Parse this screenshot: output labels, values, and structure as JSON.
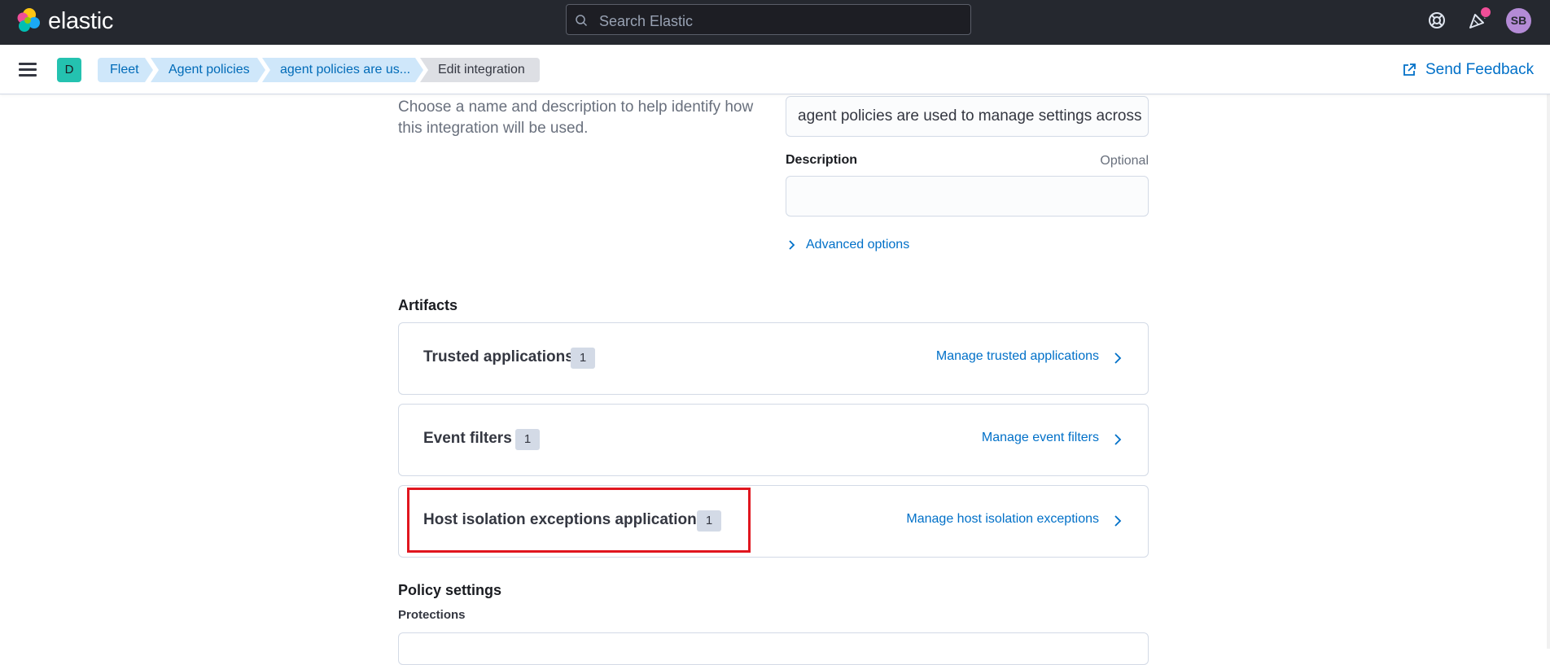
{
  "header": {
    "logo_text": "elastic",
    "search_placeholder": "Search Elastic",
    "avatar_initials": "SB"
  },
  "breadcrumb_bar": {
    "space_initial": "D",
    "crumbs": [
      "Fleet",
      "Agent policies",
      "agent policies are us...",
      "Edit integration"
    ],
    "send_feedback_label": "Send Feedback"
  },
  "integration_settings": {
    "help_text": "Choose a name and description to help identify how this integration will be used.",
    "name_value": "agent policies are used to manage settings across",
    "description_label": "Description",
    "description_optional": "Optional",
    "description_value": "",
    "advanced_options_label": "Advanced options"
  },
  "artifacts": {
    "title": "Artifacts",
    "cards": [
      {
        "title": "Trusted applications",
        "count": "1",
        "link": "Manage trusted applications"
      },
      {
        "title": "Event filters",
        "count": "1",
        "link": "Manage event filters"
      },
      {
        "title": "Host isolation exceptions applications",
        "count": "1",
        "link": "Manage host isolation exceptions"
      }
    ]
  },
  "policy_settings": {
    "title": "Policy settings",
    "protections_label": "Protections"
  },
  "colors": {
    "header_bg": "#25282f",
    "link": "#0070c8",
    "crumb_bg": "#cfe7fa",
    "highlight": "#e0161f",
    "space_badge": "#24c2b0",
    "avatar": "#b48bd6"
  }
}
